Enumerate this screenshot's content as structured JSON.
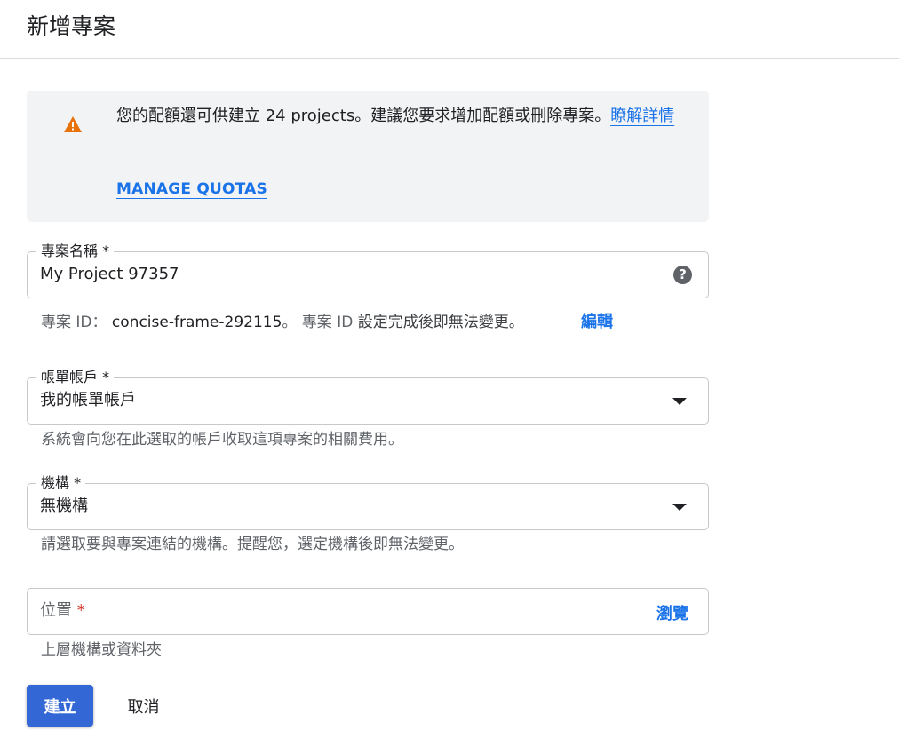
{
  "page": {
    "title": "新增專案"
  },
  "notice": {
    "text": "您的配額還可供建立 24 projects。建議您要求增加配額或刪除專案。",
    "learn_more": "瞭解詳情",
    "manage_quotas": "MANAGE QUOTAS",
    "icon": "warning-icon",
    "icon_color": "#e8710a"
  },
  "project_name": {
    "label": "專案名稱 *",
    "value": "My Project 97357",
    "help_icon": "help-icon"
  },
  "project_id": {
    "prefix": "專案 ID：",
    "value": "concise-frame-292115",
    "separator": "。",
    "note_prefix": "專案 ID",
    "note": " 設定完成後即無法變更。",
    "edit": "編輯"
  },
  "billing": {
    "label": "帳單帳戶 *",
    "value": "我的帳單帳戶",
    "hint": "系統會向您在此選取的帳戶收取這項專案的相關費用。"
  },
  "organization": {
    "label": "機構 *",
    "value": "無機構",
    "hint": "請選取要與專案連結的機構。提醒您，選定機構後即無法變更。"
  },
  "location": {
    "placeholder": "位置",
    "required_mark": "*",
    "browse": "瀏覽",
    "hint": "上層機構或資料夾"
  },
  "actions": {
    "create": "建立",
    "cancel": "取消"
  },
  "colors": {
    "accent": "#1a73e8",
    "primary_button": "#3367d6",
    "required": "#d93025",
    "notice_bg": "#f1f3f4"
  }
}
